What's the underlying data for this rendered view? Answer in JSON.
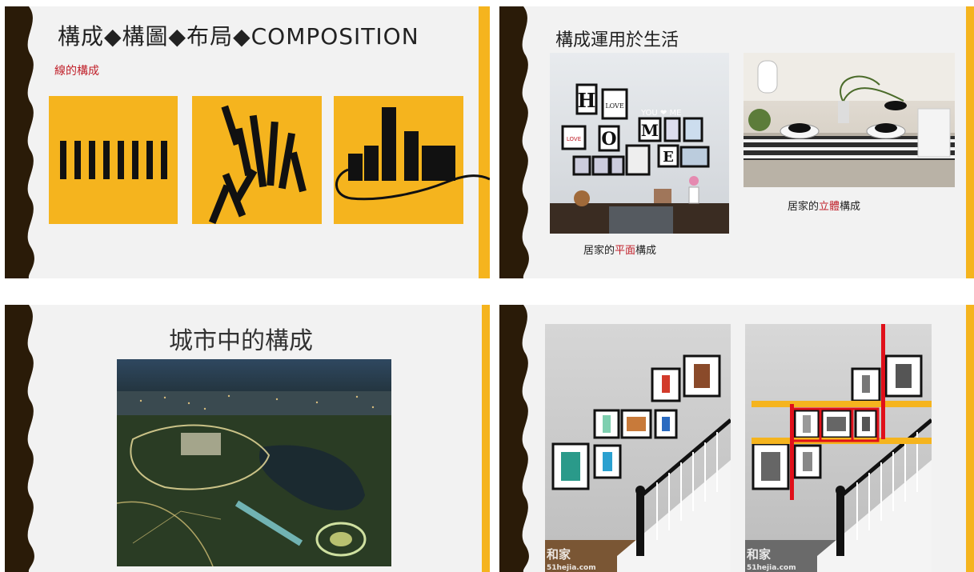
{
  "slide1": {
    "title": "構成◆構圖◆布局◆COMPOSITION",
    "subtitle": "線的構成"
  },
  "slide2": {
    "title": "構成運用於生活",
    "photo_text": {
      "letters": [
        "H",
        "O",
        "M",
        "E"
      ],
      "you_me": "YOU ❤ ME",
      "love1": "LOVE",
      "love2": "LOVE"
    },
    "caption_left": {
      "prefix": "居家的",
      "highlight": "平面",
      "suffix": "構成"
    },
    "caption_right": {
      "prefix": "居家的",
      "highlight": "立體",
      "suffix": "構成"
    }
  },
  "slide3": {
    "title": "城市中的構成"
  },
  "slide4": {
    "watermark_left": "和家",
    "watermark_left_url": "51hejia.com",
    "watermark_right": "和家",
    "watermark_right_url": "51hejia.com"
  },
  "colors": {
    "accent_yellow": "#f5b41e",
    "dark_brown": "#2a1b08",
    "highlight_red": "#c0202a"
  }
}
